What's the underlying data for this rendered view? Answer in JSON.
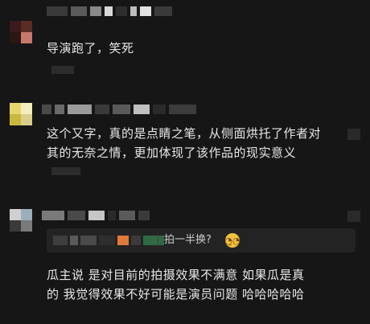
{
  "comments": [
    {
      "id": "c1",
      "text_lines": [
        "导演跑了，笑死"
      ]
    },
    {
      "id": "c2",
      "text_lines": [
        "这个又字，真的是点睛之笔，从侧面烘托了作者对",
        "其的无奈之情，更加体现了该作品的现实意义"
      ]
    },
    {
      "id": "c3",
      "quote": {
        "text": "拍一半换?",
        "emoji": "confused-face"
      },
      "text_lines": [
        "瓜主说 是对目前的拍摄效果不满意  如果瓜是真",
        "的  我觉得效果不好可能是演员问题  哈哈哈哈哈"
      ]
    }
  ],
  "colors": {
    "background": "#161616",
    "text": "#e8e8e8",
    "quote_bg": "#232323",
    "emoji": "#f3c242"
  }
}
